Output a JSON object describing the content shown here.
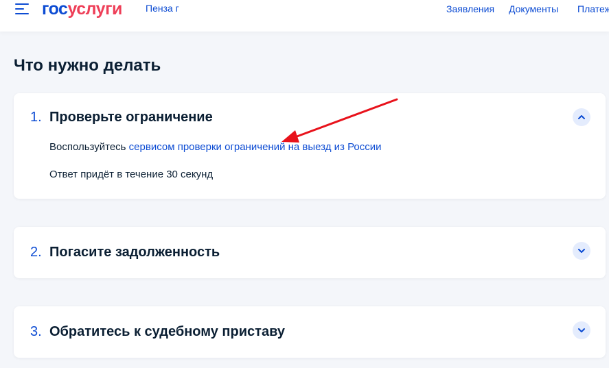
{
  "header": {
    "logo_part1": "гос",
    "logo_part2": "услуги",
    "region": "Пенза г",
    "nav": [
      "Заявления",
      "Документы",
      "Платеж"
    ]
  },
  "page_title": "Что нужно делать",
  "steps": [
    {
      "number": "1.",
      "title": "Проверьте ограничение",
      "expanded": true,
      "text_prefix": "Воспользуйтесь ",
      "link_text": "сервисом проверки ограничений на выезд из России",
      "note": "Ответ придёт в течение 30 секунд"
    },
    {
      "number": "2.",
      "title": "Погасите задолженность",
      "expanded": false
    },
    {
      "number": "3.",
      "title": "Обратитесь к судебному приставу",
      "expanded": false
    }
  ],
  "colors": {
    "primary": "#0d4cd3",
    "accent_red": "#ee3f58",
    "annotation_arrow": "#e8121b",
    "text": "#0b1f33",
    "background": "#f4f6fa"
  },
  "icons": {
    "menu": "burger-menu-icon",
    "expanded": "chevron-up-icon",
    "collapsed": "chevron-down-icon"
  }
}
